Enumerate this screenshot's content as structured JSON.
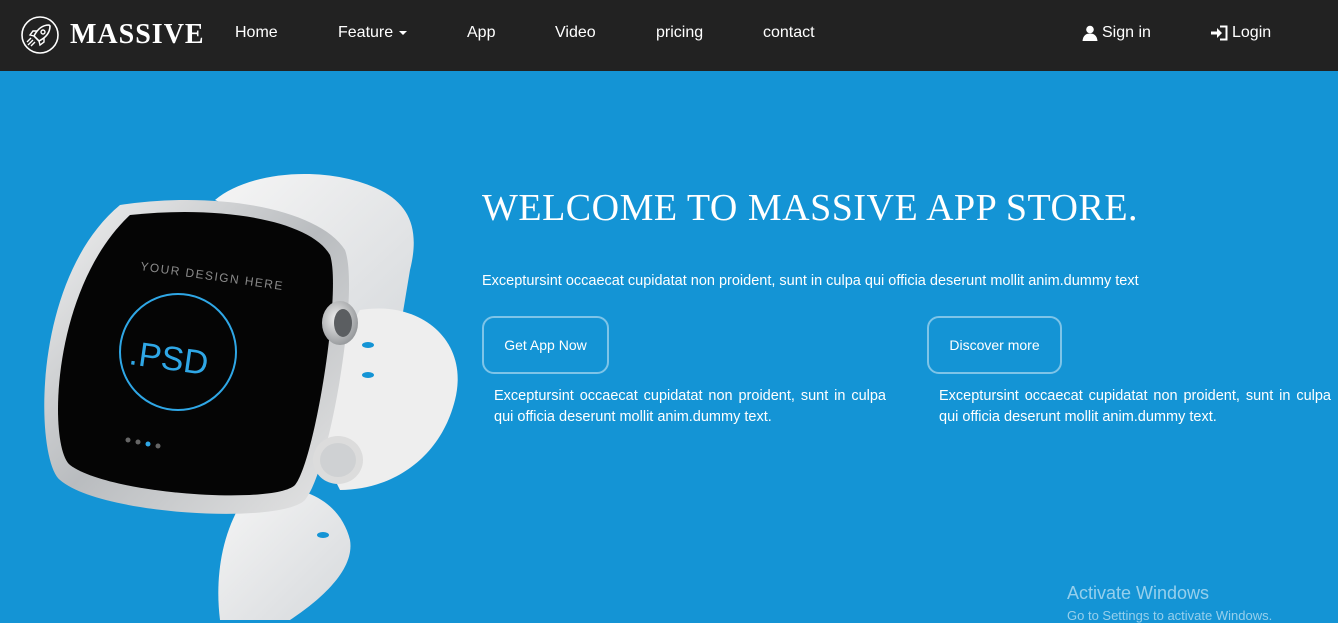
{
  "brand": {
    "name": "MASSIVE",
    "icon": "rocket-icon"
  },
  "nav": {
    "home": "Home",
    "feature": "Feature",
    "app": "App",
    "video": "Video",
    "pricing": "pricing",
    "contact": "contact",
    "sign_in": "Sign in",
    "login": "Login"
  },
  "hero": {
    "title": "WELCOME TO MASSIVE APP STORE.",
    "subtitle": "Exceptursint occaecat cupidatat non proident, sunt in culpa qui officia deserunt mollit anim.dummy text",
    "buttons": {
      "get_app": "Get App Now",
      "discover": "Discover more"
    },
    "blurbs": [
      "Exceptursint occaecat cupidatat non proident, sunt in culpa qui officia deserunt mollit anim.dummy text.",
      "Exceptursint occaecat cupidatat non proident, sunt in culpa qui officia deserunt mollit anim.dummy text."
    ]
  },
  "watch_screen": {
    "caption": "YOUR DESIGN HERE",
    "label": ".PSD"
  },
  "watermark": {
    "title": "Activate Windows",
    "subtitle": "Go to Settings to activate Windows."
  },
  "colors": {
    "navbar": "#222222",
    "hero_bg": "#1494d5",
    "text": "#ffffff",
    "watch_ring": "#2fa7e6"
  }
}
